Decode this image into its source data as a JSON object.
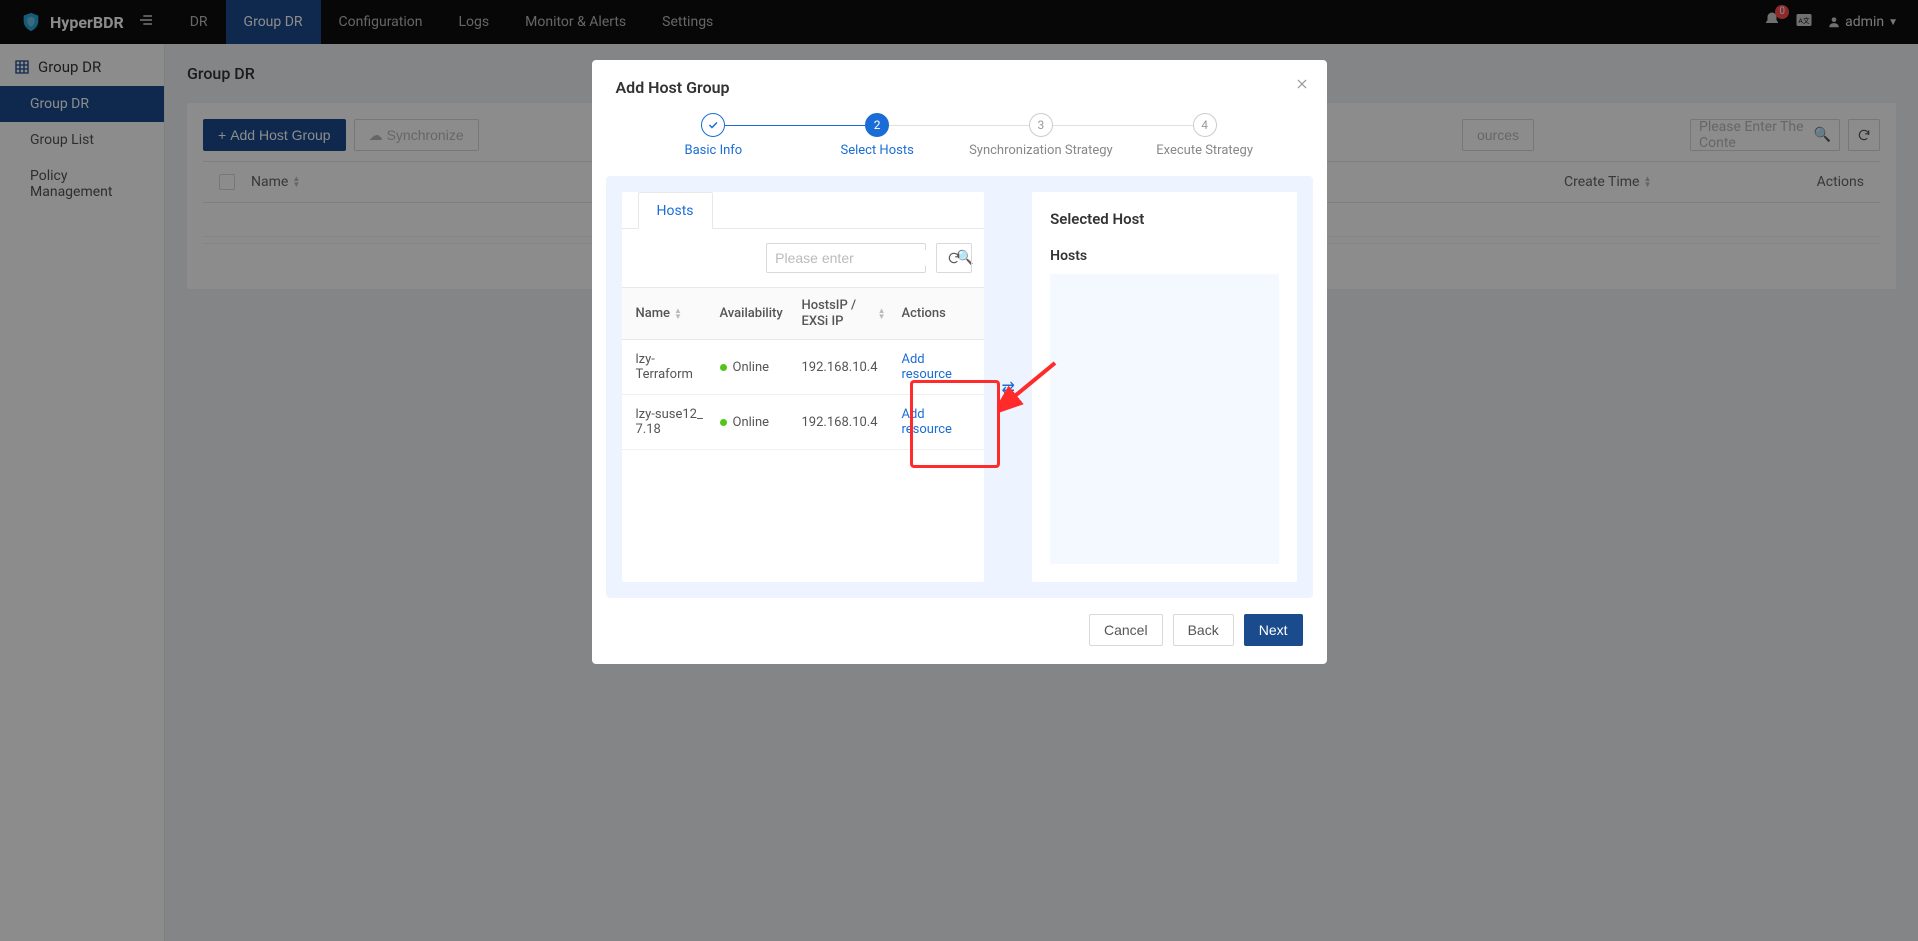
{
  "brand": "HyperBDR",
  "nav": [
    "DR",
    "Group DR",
    "Configuration",
    "Logs",
    "Monitor & Alerts",
    "Settings"
  ],
  "nav_active_index": 1,
  "notif_count": "0",
  "user": "admin",
  "sidebar": {
    "title": "Group DR",
    "items": [
      "Group DR",
      "Group List",
      "Policy Management"
    ],
    "active_index": 0
  },
  "page_title": "Group DR",
  "toolbar": {
    "add": "Add Host Group",
    "sync": "Synchronize",
    "sources": "ources",
    "search_placeholder": "Please Enter The Conte"
  },
  "bg_table": {
    "col_name": "Name",
    "col_create": "Create Time",
    "col_actions": "Actions"
  },
  "modal": {
    "title": "Add Host Group",
    "steps": [
      "Basic Info",
      "Select Hosts",
      "Synchronization Strategy",
      "Execute Strategy"
    ],
    "tab": "Hosts",
    "search_placeholder": "Please enter",
    "table": {
      "cols": {
        "name": "Name",
        "avail": "Availability",
        "ip": "HostsIP / EXSi IP",
        "actions": "Actions"
      },
      "rows": [
        {
          "name": "lzy-Terraform",
          "status": "Online",
          "ip": "192.168.10.4",
          "action": "Add resource"
        },
        {
          "name": "lzy-suse12_7.18",
          "status": "Online",
          "ip": "192.168.10.4",
          "action": "Add resource"
        }
      ]
    },
    "selected_title": "Selected Host",
    "selected_sub": "Hosts",
    "buttons": {
      "cancel": "Cancel",
      "back": "Back",
      "next": "Next"
    }
  }
}
